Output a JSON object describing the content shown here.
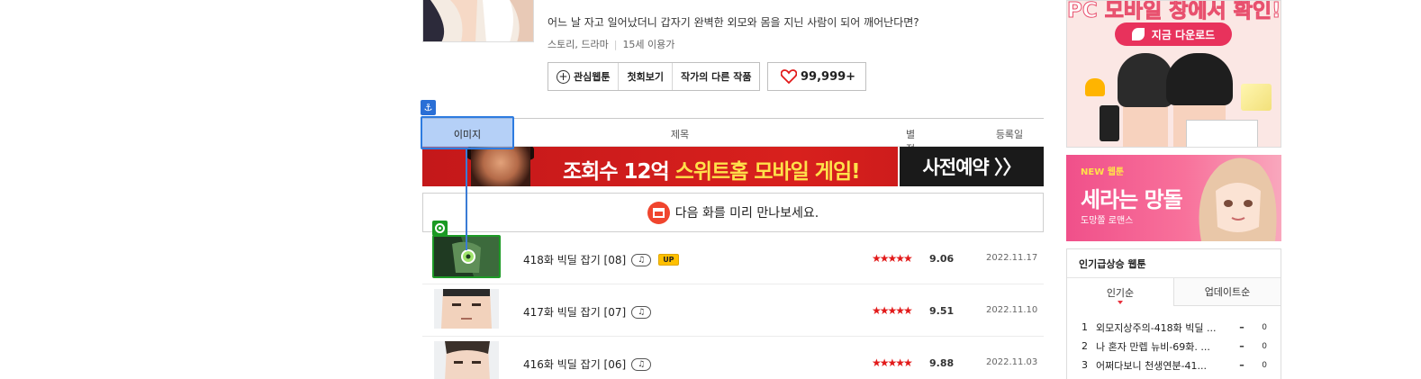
{
  "webtoon": {
    "synopsis": "어느 날 자고 일어났더니 갑자기 완벽한 외모와 몸을 지닌 사람이 되어 깨어난다면?",
    "genre": "스토리, 드라마",
    "age": "15세 이용가",
    "buttons": {
      "favorite": "관심웹툰",
      "first": "첫회보기",
      "other_works": "작가의 다른 작품",
      "likes": "99,999+"
    }
  },
  "table": {
    "headers": {
      "image": "이미지",
      "title": "제목",
      "rating": "별점",
      "date": "등록일"
    }
  },
  "banner": {
    "text_main": "조회수 12억 ",
    "text_highlight": "스위트홈 모바일 게임!",
    "cta": "사전예약 〉〉"
  },
  "preview": {
    "text": "다음 화를 미리 만나보세요."
  },
  "episodes": [
    {
      "title": "418화 빅딜 잡기 [08]",
      "badge": "UP",
      "stars": "★★★★★",
      "score": "9.06",
      "date": "2022.11.17"
    },
    {
      "title": "417화 빅딜 잡기 [07]",
      "badge": "",
      "stars": "★★★★★",
      "score": "9.51",
      "date": "2022.11.10"
    },
    {
      "title": "416화 빅딜 잡기 [06]",
      "badge": "",
      "stars": "★★★★★",
      "score": "9.88",
      "date": "2022.11.03"
    }
  ],
  "sidebar": {
    "ad_top": {
      "headline": "PC 모바일 창에서 확인!",
      "download": "지금 다운로드"
    },
    "ad_new": {
      "tag": "NEW 웹툰",
      "title": "세라는 망돌",
      "subtitle": "도망쫄 로맨스"
    },
    "ranking": {
      "title": "인기급상승 웹툰",
      "tabs": [
        "인기순",
        "업데이트순"
      ],
      "items": [
        {
          "rank": "1",
          "title": "외모지상주의-418화 빅딜 ...",
          "change": "0"
        },
        {
          "rank": "2",
          "title": "나 혼자 만렙 뉴비-69화. ...",
          "change": "0"
        },
        {
          "rank": "3",
          "title": "어쩌다보니 천생연분-41...",
          "change": "0"
        }
      ]
    }
  },
  "colors": {
    "accent_red": "#e21a1a",
    "selection_blue": "#2d7be0",
    "selection_green": "#1e9b27"
  }
}
